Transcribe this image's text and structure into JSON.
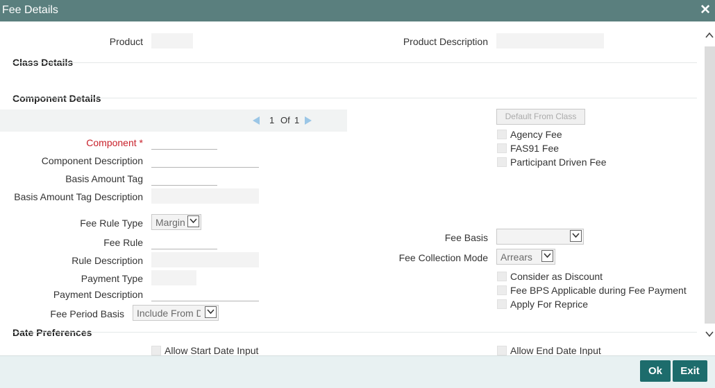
{
  "window": {
    "title": "Fee Details",
    "close_icon": "✕"
  },
  "product": {
    "label": "Product",
    "value": "",
    "description_label": "Product Description",
    "description_value": ""
  },
  "class_details": {
    "heading": "Class Details"
  },
  "component_details": {
    "heading": "Component Details",
    "pager": {
      "current": "1",
      "of_label": "Of",
      "total": "1"
    },
    "default_from_class_label": "Default From Class",
    "component_label": "Component",
    "required_marker": "*",
    "component_description_label": "Component Description",
    "basis_amount_tag_label": "Basis Amount Tag",
    "basis_amount_tag_description_label": "Basis Amount Tag Description",
    "fee_rule_type_label": "Fee Rule Type",
    "fee_rule_type_value": "Margin",
    "fee_rule_label": "Fee Rule",
    "rule_description_label": "Rule Description",
    "payment_type_label": "Payment Type",
    "payment_description_label": "Payment Description",
    "fee_period_basis_label": "Fee Period Basis",
    "fee_period_basis_value": "Include From Dt",
    "fee_basis_label": "Fee Basis",
    "fee_basis_value": "",
    "fee_collection_mode_label": "Fee Collection Mode",
    "fee_collection_mode_value": "Arrears",
    "checkboxes": {
      "agency_fee": "Agency Fee",
      "fas91_fee": "FAS91 Fee",
      "participant_driven_fee": "Participant Driven Fee",
      "consider_as_discount": "Consider as Discount",
      "fee_bps_applicable": "Fee BPS Applicable during Fee Payment",
      "apply_for_reprice": "Apply For Reprice"
    }
  },
  "date_preferences": {
    "heading": "Date Preferences",
    "allow_start_date_input": "Allow Start Date Input",
    "allow_end_date_input": "Allow End Date Input"
  },
  "footer": {
    "ok_label": "Ok",
    "exit_label": "Exit"
  },
  "colors": {
    "title_bar": "#5a7f7e",
    "button": "#1d6c6c",
    "required": "#c8202a",
    "pager_arrow": "#9bc6e6"
  }
}
